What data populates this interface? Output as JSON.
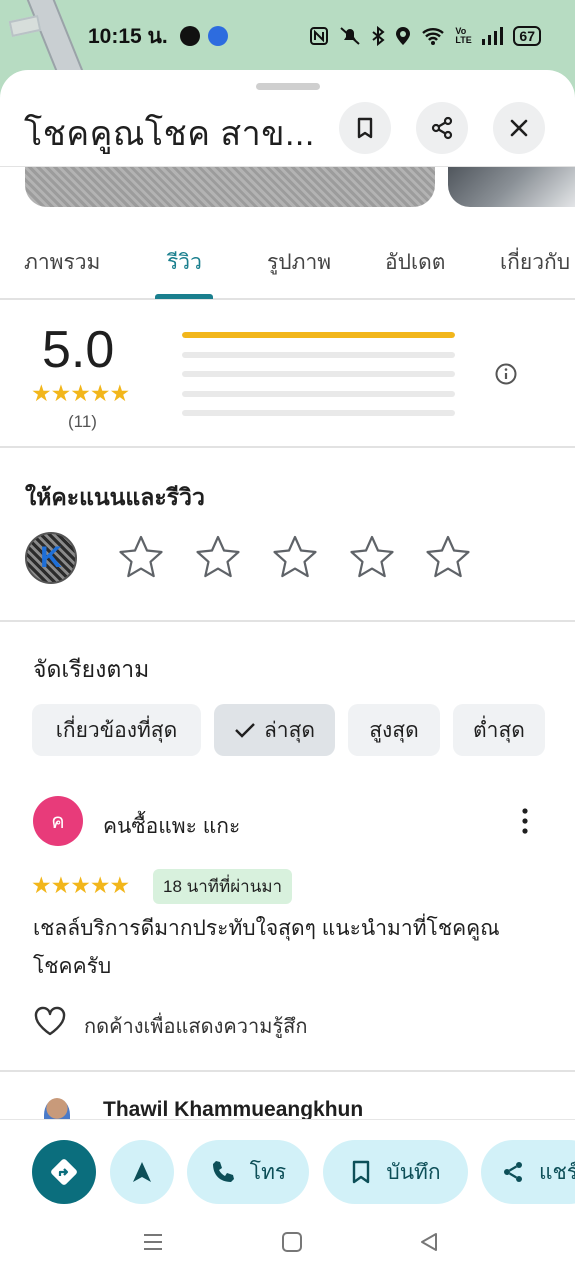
{
  "status_bar": {
    "time": "10:15 น.",
    "battery": "67",
    "network": "Vo LTE"
  },
  "header": {
    "title": "โชคคูณโชค สาข...",
    "buttons": [
      "bookmark-icon",
      "share-icon",
      "close-icon"
    ]
  },
  "tabs": [
    {
      "label": "ภาพรวม",
      "active": false
    },
    {
      "label": "รีวิว",
      "active": true
    },
    {
      "label": "รูปภาพ",
      "active": false
    },
    {
      "label": "อัปเดต",
      "active": false
    },
    {
      "label": "เกี่ยวกับ",
      "active": false
    }
  ],
  "rating_summary": {
    "average": "5.0",
    "stars": "★★★★★",
    "count": "(11)",
    "distribution": [
      {
        "stars": 5,
        "fraction": 1.0
      },
      {
        "stars": 4,
        "fraction": 0.0
      },
      {
        "stars": 3,
        "fraction": 0.0
      },
      {
        "stars": 2,
        "fraction": 0.0
      },
      {
        "stars": 1,
        "fraction": 0.0
      }
    ]
  },
  "rate_and_review": {
    "title": "ให้คะแนนและรีวิว",
    "avatar_letter": "K",
    "empty_stars": 5
  },
  "sort": {
    "label": "จัดเรียงตาม",
    "chips": [
      {
        "label": "เกี่ยวข้องที่สุด",
        "selected": false
      },
      {
        "label": "ล่าสุด",
        "selected": true
      },
      {
        "label": "สูงสุด",
        "selected": false
      },
      {
        "label": "ต่ำสุด",
        "selected": false
      }
    ]
  },
  "reviews": [
    {
      "avatar_letter": "ค",
      "avatar_color": "#e83b7a",
      "name": "คนซื้อแพะ แกะ",
      "stars": "★★★★★",
      "time": "18 นาทีที่ผ่านมา",
      "text": "เชลล์บริการดีมากประทับใจสุดๆ แนะนำมาที่โชคคูณโชคครับ",
      "reaction_hint": "กดค้างเพื่อแสดงความรู้สึก"
    },
    {
      "name": "Thawil Khammueangkhun"
    }
  ],
  "actions": {
    "call": "โทร",
    "save": "บันทึก",
    "share": "แชร์"
  },
  "colors": {
    "accent": "#1a7f8e",
    "star": "#f2b61b",
    "primary_action": "#0b6e7d",
    "pill_bg": "#d2f1f8"
  }
}
